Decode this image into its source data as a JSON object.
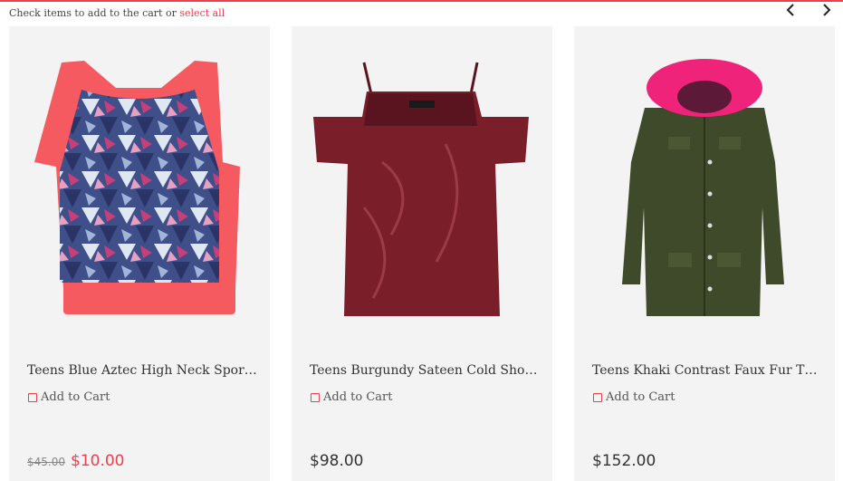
{
  "header": {
    "hint_text": "Check items to add to the cart or ",
    "select_all": "select all"
  },
  "colors": {
    "accent": "#e8414d",
    "card_bg": "#f3f3f3"
  },
  "icons": {
    "prev": "chevron-left-icon",
    "next": "chevron-right-icon"
  },
  "products": [
    {
      "title": "Teens Blue Aztec High Neck Sports..",
      "add_label": "Add to Cart",
      "old_price": "$45.00",
      "price": "$10.00"
    },
    {
      "title": "Teens Burgundy Sateen Cold Shoul...",
      "add_label": "Add to Cart",
      "price": "$98.00"
    },
    {
      "title": "Teens Khaki Contrast Faux Fur Tri...",
      "add_label": "Add to Cart",
      "price": "$152.00"
    }
  ]
}
